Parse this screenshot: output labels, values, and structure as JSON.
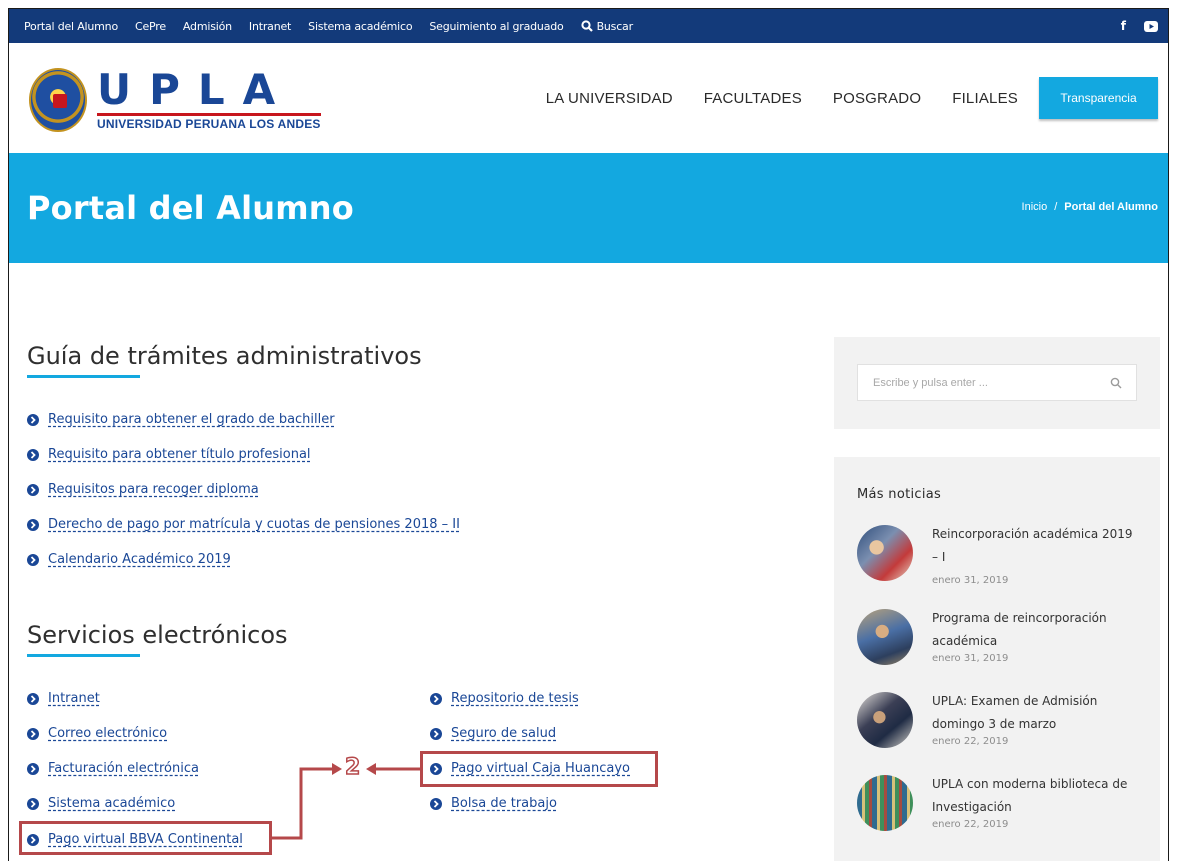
{
  "topbar": {
    "links": [
      "Portal del Alumno",
      "CePre",
      "Admisión",
      "Intranet",
      "Sistema académico",
      "Seguimiento al graduado"
    ],
    "search_label": "Buscar"
  },
  "header": {
    "logo_letters": "UPLA",
    "logo_subtitle": "UNIVERSIDAD PERUANA LOS ANDES",
    "nav": [
      "LA UNIVERSIDAD",
      "FACULTADES",
      "POSGRADO",
      "FILIALES"
    ],
    "cta_label": "Transparencia"
  },
  "banner": {
    "title": "Portal del Alumno",
    "breadcrumb": [
      "Inicio",
      "Portal del Alumno"
    ],
    "breadcrumb_separator": "/"
  },
  "guia": {
    "title": "Guía de trámites administrativos",
    "links": [
      "Requisito para obtener el grado de bachiller",
      "Requisito para obtener título profesional",
      "Requisitos para recoger diploma",
      "Derecho de pago por matrícula y cuotas de pensiones 2018 – II",
      "Calendario Académico 2019"
    ]
  },
  "servicios": {
    "title": "Servicios electrónicos",
    "col1": [
      "Intranet",
      "Correo electrónico",
      "Facturación electrónica",
      "Sistema académico",
      "Pago virtual BBVA Continental"
    ],
    "col2": [
      "Repositorio de tesis",
      "Seguro de salud",
      "Pago virtual Caja Huancayo",
      "Bolsa de trabajo"
    ]
  },
  "annotation": {
    "step_number": "2",
    "color": "#b5484a"
  },
  "sidebar": {
    "search_placeholder": "Escribe y pulsa enter ...",
    "news_heading": "Más noticias",
    "news": [
      {
        "title": "Reincorporación académica 2019 – I",
        "date": "enero 31, 2019"
      },
      {
        "title": "Programa de reincorporación académica",
        "date": "enero 31, 2019"
      },
      {
        "title": "UPLA: Examen de Admisión domingo 3 de marzo",
        "date": "enero 22, 2019"
      },
      {
        "title": "UPLA con moderna biblioteca de Investigación",
        "date": "enero 22, 2019"
      }
    ]
  },
  "colors": {
    "topbar": "#133a7a",
    "accent": "#13a8e0",
    "link": "#1a4796",
    "brand_red": "#c7161d"
  }
}
